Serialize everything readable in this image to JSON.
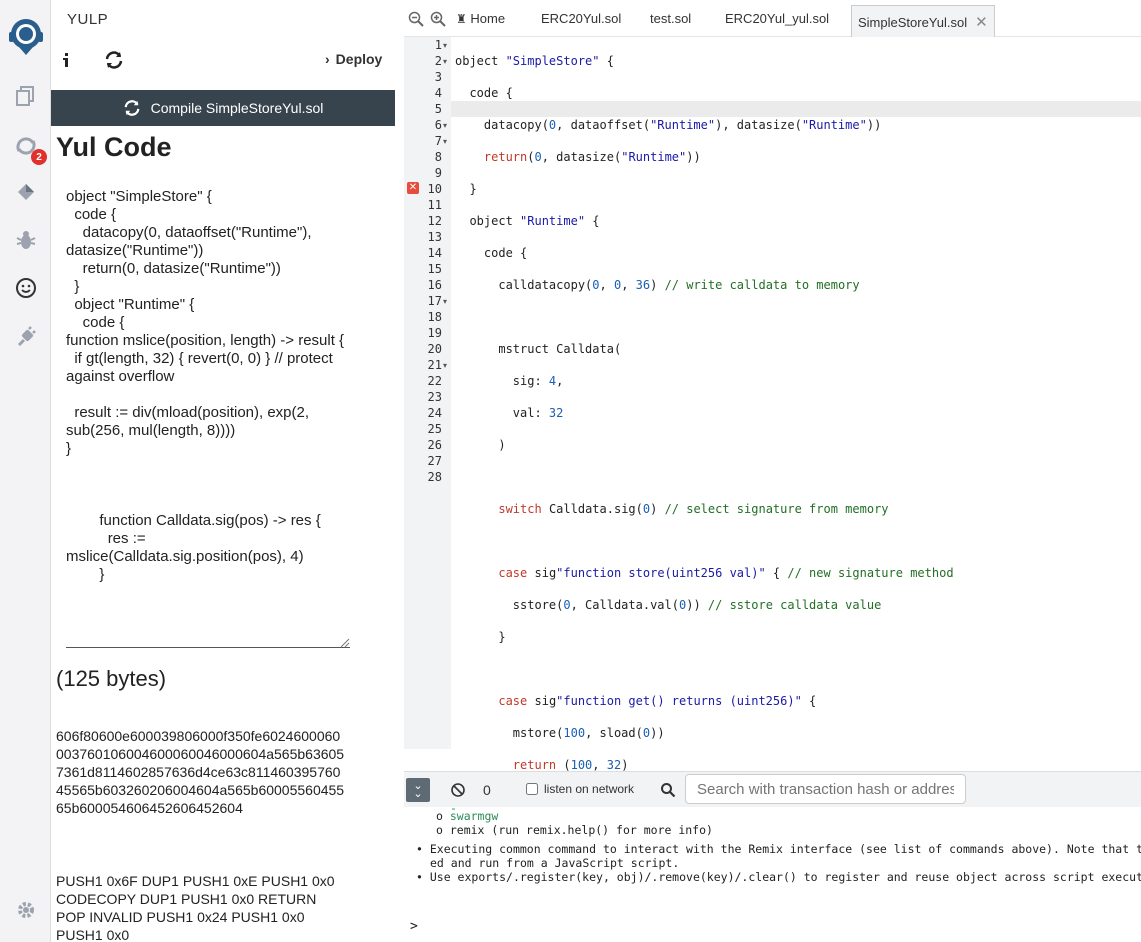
{
  "app": {
    "plugin_title": "YULP",
    "deploy_label": "Deploy",
    "compile_label": "Compile  SimpleStoreYul.sol",
    "notification_count": "2"
  },
  "panel": {
    "heading": "Yul Code",
    "yul_code": "object \"SimpleStore\" {\n  code {\n    datacopy(0, dataoffset(\"Runtime\"), datasize(\"Runtime\"))\n    return(0, datasize(\"Runtime\"))\n  }\n  object \"Runtime\" {\n    code {\nfunction mslice(position, length) -> result {\n  if gt(length, 32) { revert(0, 0) } // protect against overflow\n\n  result := div(mload(position), exp(2, sub(256, mul(length, 8))))\n}\n\n\n\n        function Calldata.sig(pos) -> res {\n          res := mslice(Calldata.sig.position(pos), 4)\n        }",
    "bytes_label": "125 bytes",
    "bytecode": "606f80600e600039806000f350fe6024600060003760106004600060046000604a565b636057361d8114602857636d4ce63c81146039576045565b603260206004604a565b6000556045565b600054606452606452604",
    "opcodes": "PUSH1 0x6F DUP1 PUSH1 0xE PUSH1 0x0 CODECOPY DUP1 PUSH1 0x0 RETURN POP INVALID PUSH1 0x24 PUSH1 0x0 PUSH1 0x0"
  },
  "tabs": [
    {
      "label": "Home"
    },
    {
      "label": "ERC20Yul.sol"
    },
    {
      "label": "test.sol"
    },
    {
      "label": "ERC20Yul_yul.sol"
    },
    {
      "label": "SimpleStoreYul.sol"
    }
  ],
  "editor": {
    "line_numbers": [
      "1",
      "2",
      "3",
      "4",
      "5",
      "6",
      "7",
      "8",
      "9",
      "10",
      "11",
      "12",
      "13",
      "14",
      "15",
      "16",
      "17",
      "18",
      "19",
      "20",
      "21",
      "22",
      "23",
      "24",
      "25",
      "26",
      "27",
      "28"
    ]
  },
  "terminal": {
    "tx_count": "0",
    "listen_label": "listen on network",
    "search_placeholder": "Search with transaction hash or address",
    "lines": {
      "swarmgw": "swarmgw",
      "remix": "remix (run remix.help() for more info)",
      "exec1": "Executing common command to interact with the Remix interface (see list of commands above). Note that these",
      "exec2": "ed and run from a JavaScript script.",
      "exports": "Use exports/.register(key, obj)/.remove(key)/.clear() to register and reuse object across script executions."
    },
    "prompt": ">"
  },
  "colors": {
    "accent_button": "#38444d",
    "keyword": "#c0392b",
    "string": "#1a1aa6",
    "number": "#1a5fb4",
    "comment": "#236e25",
    "error": "#e74c3c"
  }
}
